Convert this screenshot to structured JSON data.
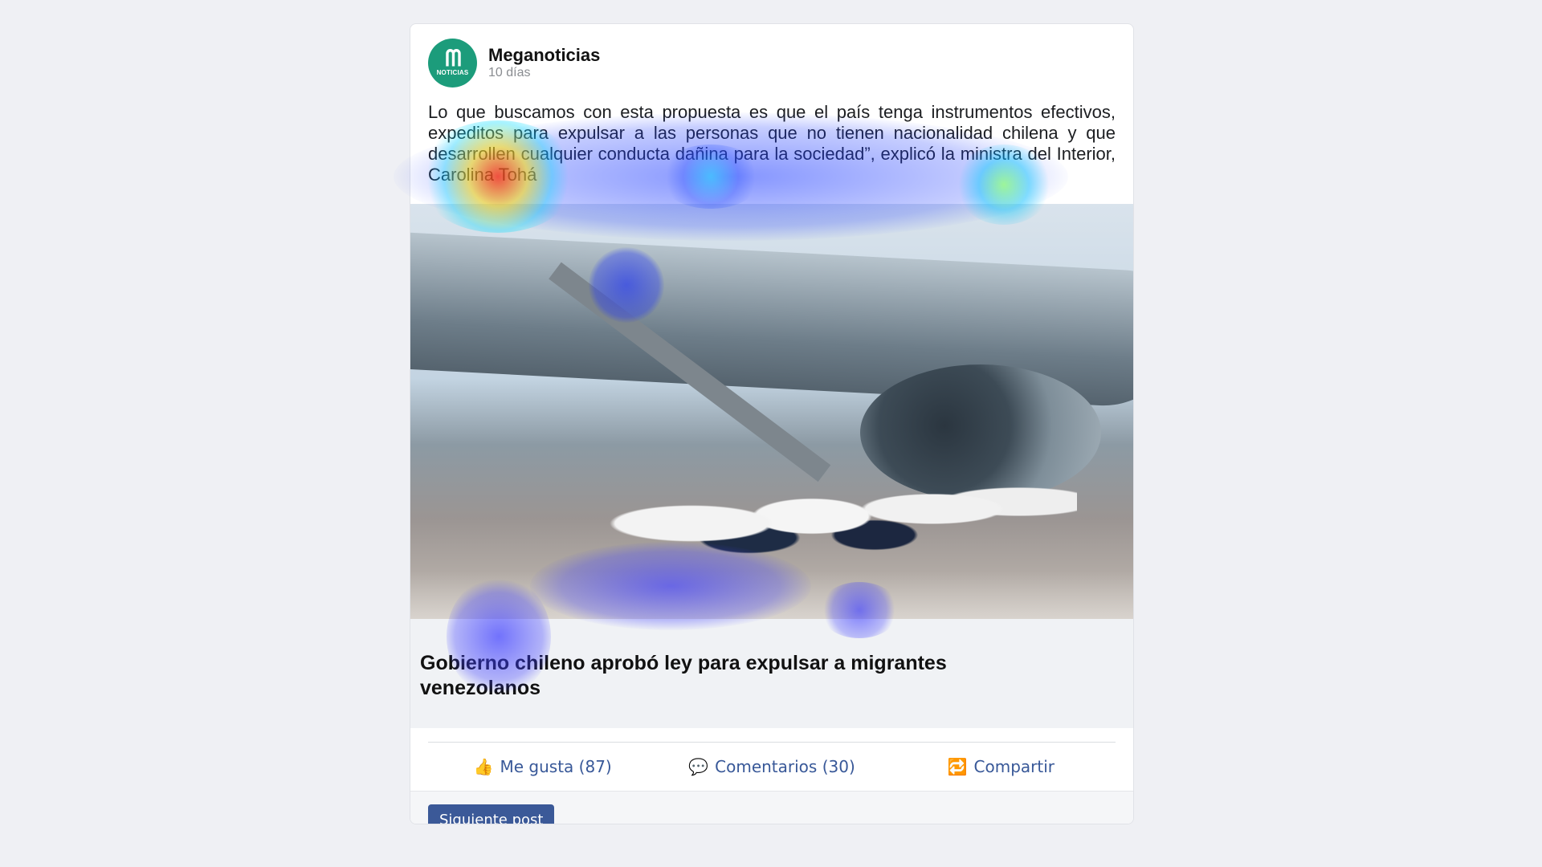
{
  "post": {
    "author": "Meganoticias",
    "avatar_mark": "ᗰ",
    "avatar_sub": "NOTICIAS",
    "time": "10 días",
    "text": "Lo que buscamos con esta propuesta es que el país tenga instrumentos efectivos, expeditos para expulsar a las personas que no tienen nacionalidad chilena y que desarrollen cualquier conducta dañina para la sociedad”, explicó la ministra del Interior, Carolina Tohá",
    "image_alt": "Personas abordando un avión en la pista",
    "link_title": "Gobierno chileno aprobó ley para expulsar a migrantes venezolanos"
  },
  "actions": {
    "like": {
      "icon": "👍",
      "label": "Me gusta (87)"
    },
    "comment": {
      "icon": "💬",
      "label": "Comentarios (30)"
    },
    "share": {
      "icon": "🔁",
      "label": "Compartir"
    }
  },
  "footer": {
    "next_label": "Siguiente post"
  },
  "colors": {
    "accent": "#3b5998",
    "action_text": "#385898",
    "avatar_bg": "#1c9c7b"
  }
}
